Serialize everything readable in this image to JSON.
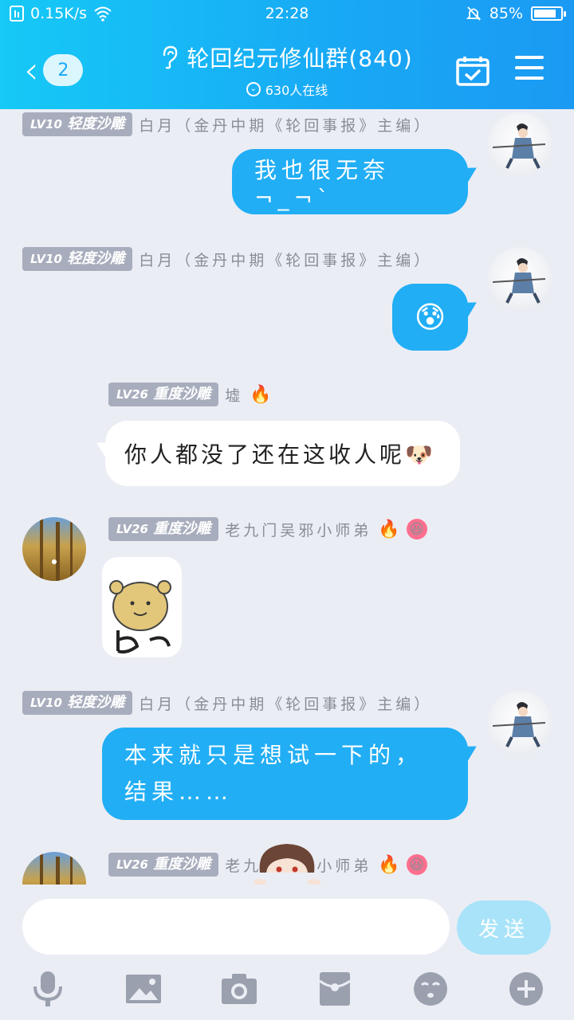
{
  "status_bar": {
    "speed": "0.15K/s",
    "time": "22:28",
    "battery": "85%",
    "battery_level": 0.85
  },
  "header": {
    "unread_count": "2",
    "group_title": "轮回纪元修仙群(840)",
    "online_text": "630人在线"
  },
  "messages": [
    {
      "level": "LV10",
      "tag": "轻度沙雕",
      "sender": "白月（金丹中期《轮回事报》主编）",
      "text": "我也很无奈¬_¬`"
    },
    {
      "level": "LV10",
      "tag": "轻度沙雕",
      "sender": "白月（金丹中期《轮回事报》主编）",
      "text": "😰"
    },
    {
      "level": "LV26",
      "tag": "重度沙雕",
      "sender": "墟",
      "text": "你人都没了还在这收人呢🐶"
    },
    {
      "level": "LV26",
      "tag": "重度沙雕",
      "sender": "老九门吴邪小师弟",
      "text": ""
    },
    {
      "level": "LV10",
      "tag": "轻度沙雕",
      "sender": "白月（金丹中期《轮回事报》主编）",
      "text": "本来就只是想试一下的，结果……"
    },
    {
      "level": "LV26",
      "tag": "重度沙雕",
      "sender": "老九门吴邪小师弟",
      "text": ""
    }
  ],
  "composer": {
    "input_value": "",
    "send_label": "发送"
  },
  "icons": {
    "voice": "microphone-icon",
    "image": "image-icon",
    "camera": "camera-icon",
    "red_packet": "red-packet-icon",
    "emoji": "emoji-icon",
    "more": "plus-icon"
  },
  "colors": {
    "header_gradient_start": "#16c9f6",
    "header_gradient_end": "#1b9af3",
    "outgoing_bubble": "#21aef5",
    "incoming_bubble": "#ffffff",
    "level_badge": "#a8adbd",
    "send_button": "#a8e3f9",
    "toolbar_icon": "#9aa0ae"
  }
}
